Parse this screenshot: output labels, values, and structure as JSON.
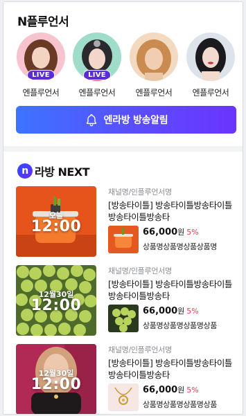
{
  "section_influencer": {
    "title": "N플루언서",
    "items": [
      {
        "name": "엔플루언서",
        "live": true,
        "live_label": "LIVE"
      },
      {
        "name": "엔플루언서",
        "live": true,
        "live_label": "LIVE"
      },
      {
        "name": "엔플루언서",
        "live": false
      },
      {
        "name": "엔플루언서",
        "live": false
      }
    ],
    "alarm_button": "엔라방 방송알림"
  },
  "section_next": {
    "logo_letter": "n",
    "title": "라방 NEXT",
    "cards": [
      {
        "day": "오늘",
        "time": "12:00",
        "channel": "채널명/인플루언서명",
        "title": "[방송타이틀] 방송타이틀방송타이틀방송타이틀방송타",
        "price": "66,000",
        "won": "원",
        "discount": "5%",
        "product": "상품명상품명상품상품명"
      },
      {
        "day": "12월30일",
        "time": "12:00",
        "channel": "채널명/인플루언서명",
        "title": "[방송타이틀] 방송타이틀방송타이틀방송타이틀방송타",
        "price": "66,000",
        "won": "원",
        "discount": "5%",
        "product": "상품명상품명상품명상품"
      },
      {
        "day": "12월30일",
        "time": "12:00",
        "channel": "채널명/인플루언서명",
        "title": "[방송타이틀] 방송타이틀방송타이틀방송타이틀방송타",
        "price": "66,000",
        "won": "원",
        "discount": "5%",
        "product": "상품명상품명상품명상품"
      }
    ]
  },
  "colors": {
    "accent": "#5a4dff",
    "live_badge": "#5a2dd6",
    "discount": "#ef3a4f"
  }
}
